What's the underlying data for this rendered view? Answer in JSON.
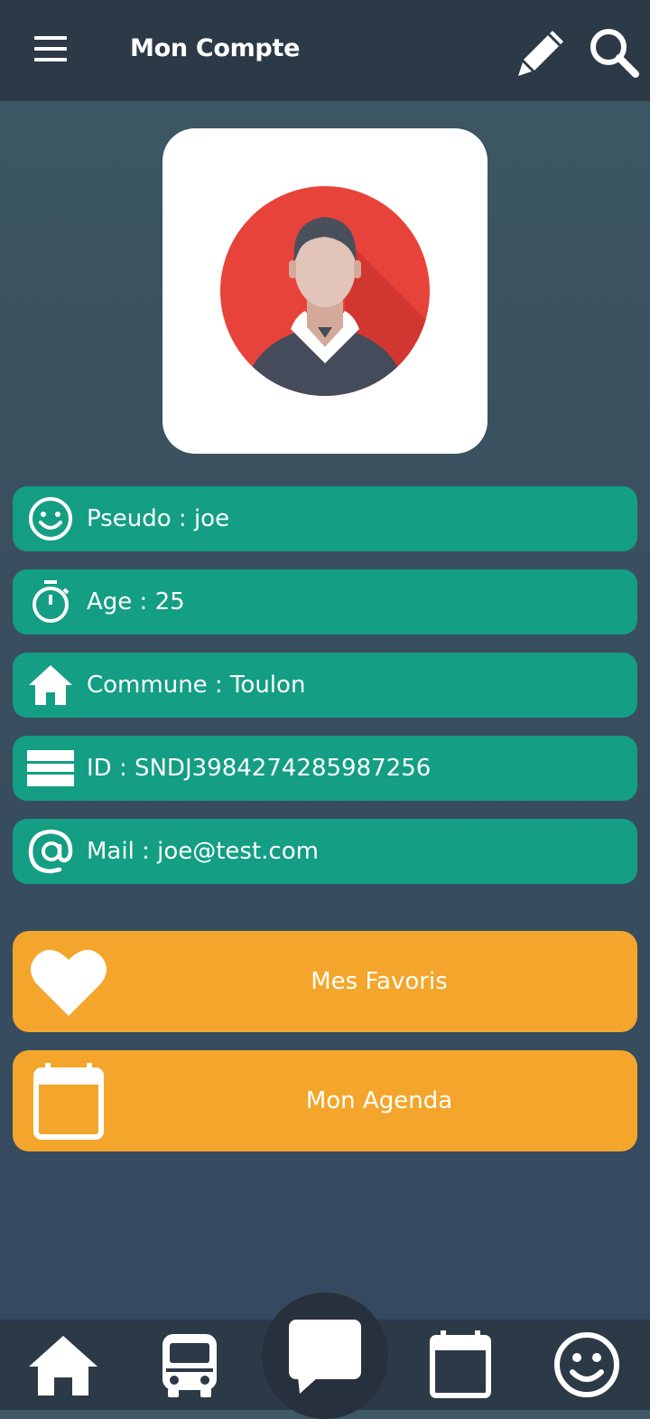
{
  "header": {
    "title": "Mon Compte"
  },
  "profile": {
    "pseudo": "Pseudo : joe",
    "age": "Age : 25",
    "commune": "Commune : Toulon",
    "id": "ID : SNDJ3984274285987256",
    "mail": "Mail : joe@test.com"
  },
  "actions": {
    "favorites": "Mes Favoris",
    "agenda": "Mon Agenda"
  },
  "colors": {
    "appbar": "#2c3a47",
    "info_row": "#149e83",
    "action_button": "#f3a62b",
    "avatar_red": "#e8433a"
  },
  "icons": {
    "header": [
      "menu-icon",
      "pencil-icon",
      "search-icon"
    ],
    "rows": [
      "smiley-icon",
      "stopwatch-icon",
      "home-icon",
      "card-icon",
      "at-icon"
    ],
    "actions": [
      "heart-icon",
      "calendar-icon"
    ],
    "nav": [
      "home-icon",
      "bus-icon",
      "chat-icon",
      "calendar-icon",
      "smiley-icon"
    ]
  }
}
